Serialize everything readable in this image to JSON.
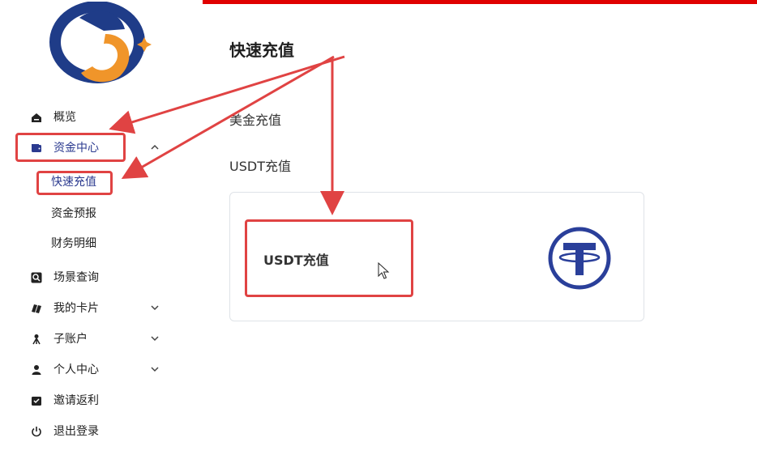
{
  "colors": {
    "accent": "#e00000",
    "annotation": "#e04343",
    "active_nav": "#2b3a8f",
    "logo_blue": "#1f3c88",
    "logo_orange": "#f0952a",
    "tether_blue": "#2a3f9a"
  },
  "sidebar": {
    "logo_icon": "brand-logo-icon",
    "items": [
      {
        "label": "概览",
        "icon": "home-icon"
      },
      {
        "label": "资金中心",
        "icon": "wallet-icon",
        "expanded": true
      },
      {
        "label": "场景查询",
        "icon": "search-icon"
      },
      {
        "label": "我的卡片",
        "icon": "cards-icon"
      },
      {
        "label": "子账户",
        "icon": "sub-account-icon"
      },
      {
        "label": "个人中心",
        "icon": "user-icon"
      },
      {
        "label": "邀请返利",
        "icon": "invite-icon"
      },
      {
        "label": "退出登录",
        "icon": "power-icon"
      }
    ],
    "funds_sub": [
      {
        "label": "快速充值",
        "active": true
      },
      {
        "label": "资金预报"
      },
      {
        "label": "财务明细"
      }
    ]
  },
  "main": {
    "title": "快速充值",
    "options": [
      "美金充值",
      "USDT充值"
    ],
    "card": {
      "label": "USDT充值",
      "icon": "tether-icon"
    }
  }
}
